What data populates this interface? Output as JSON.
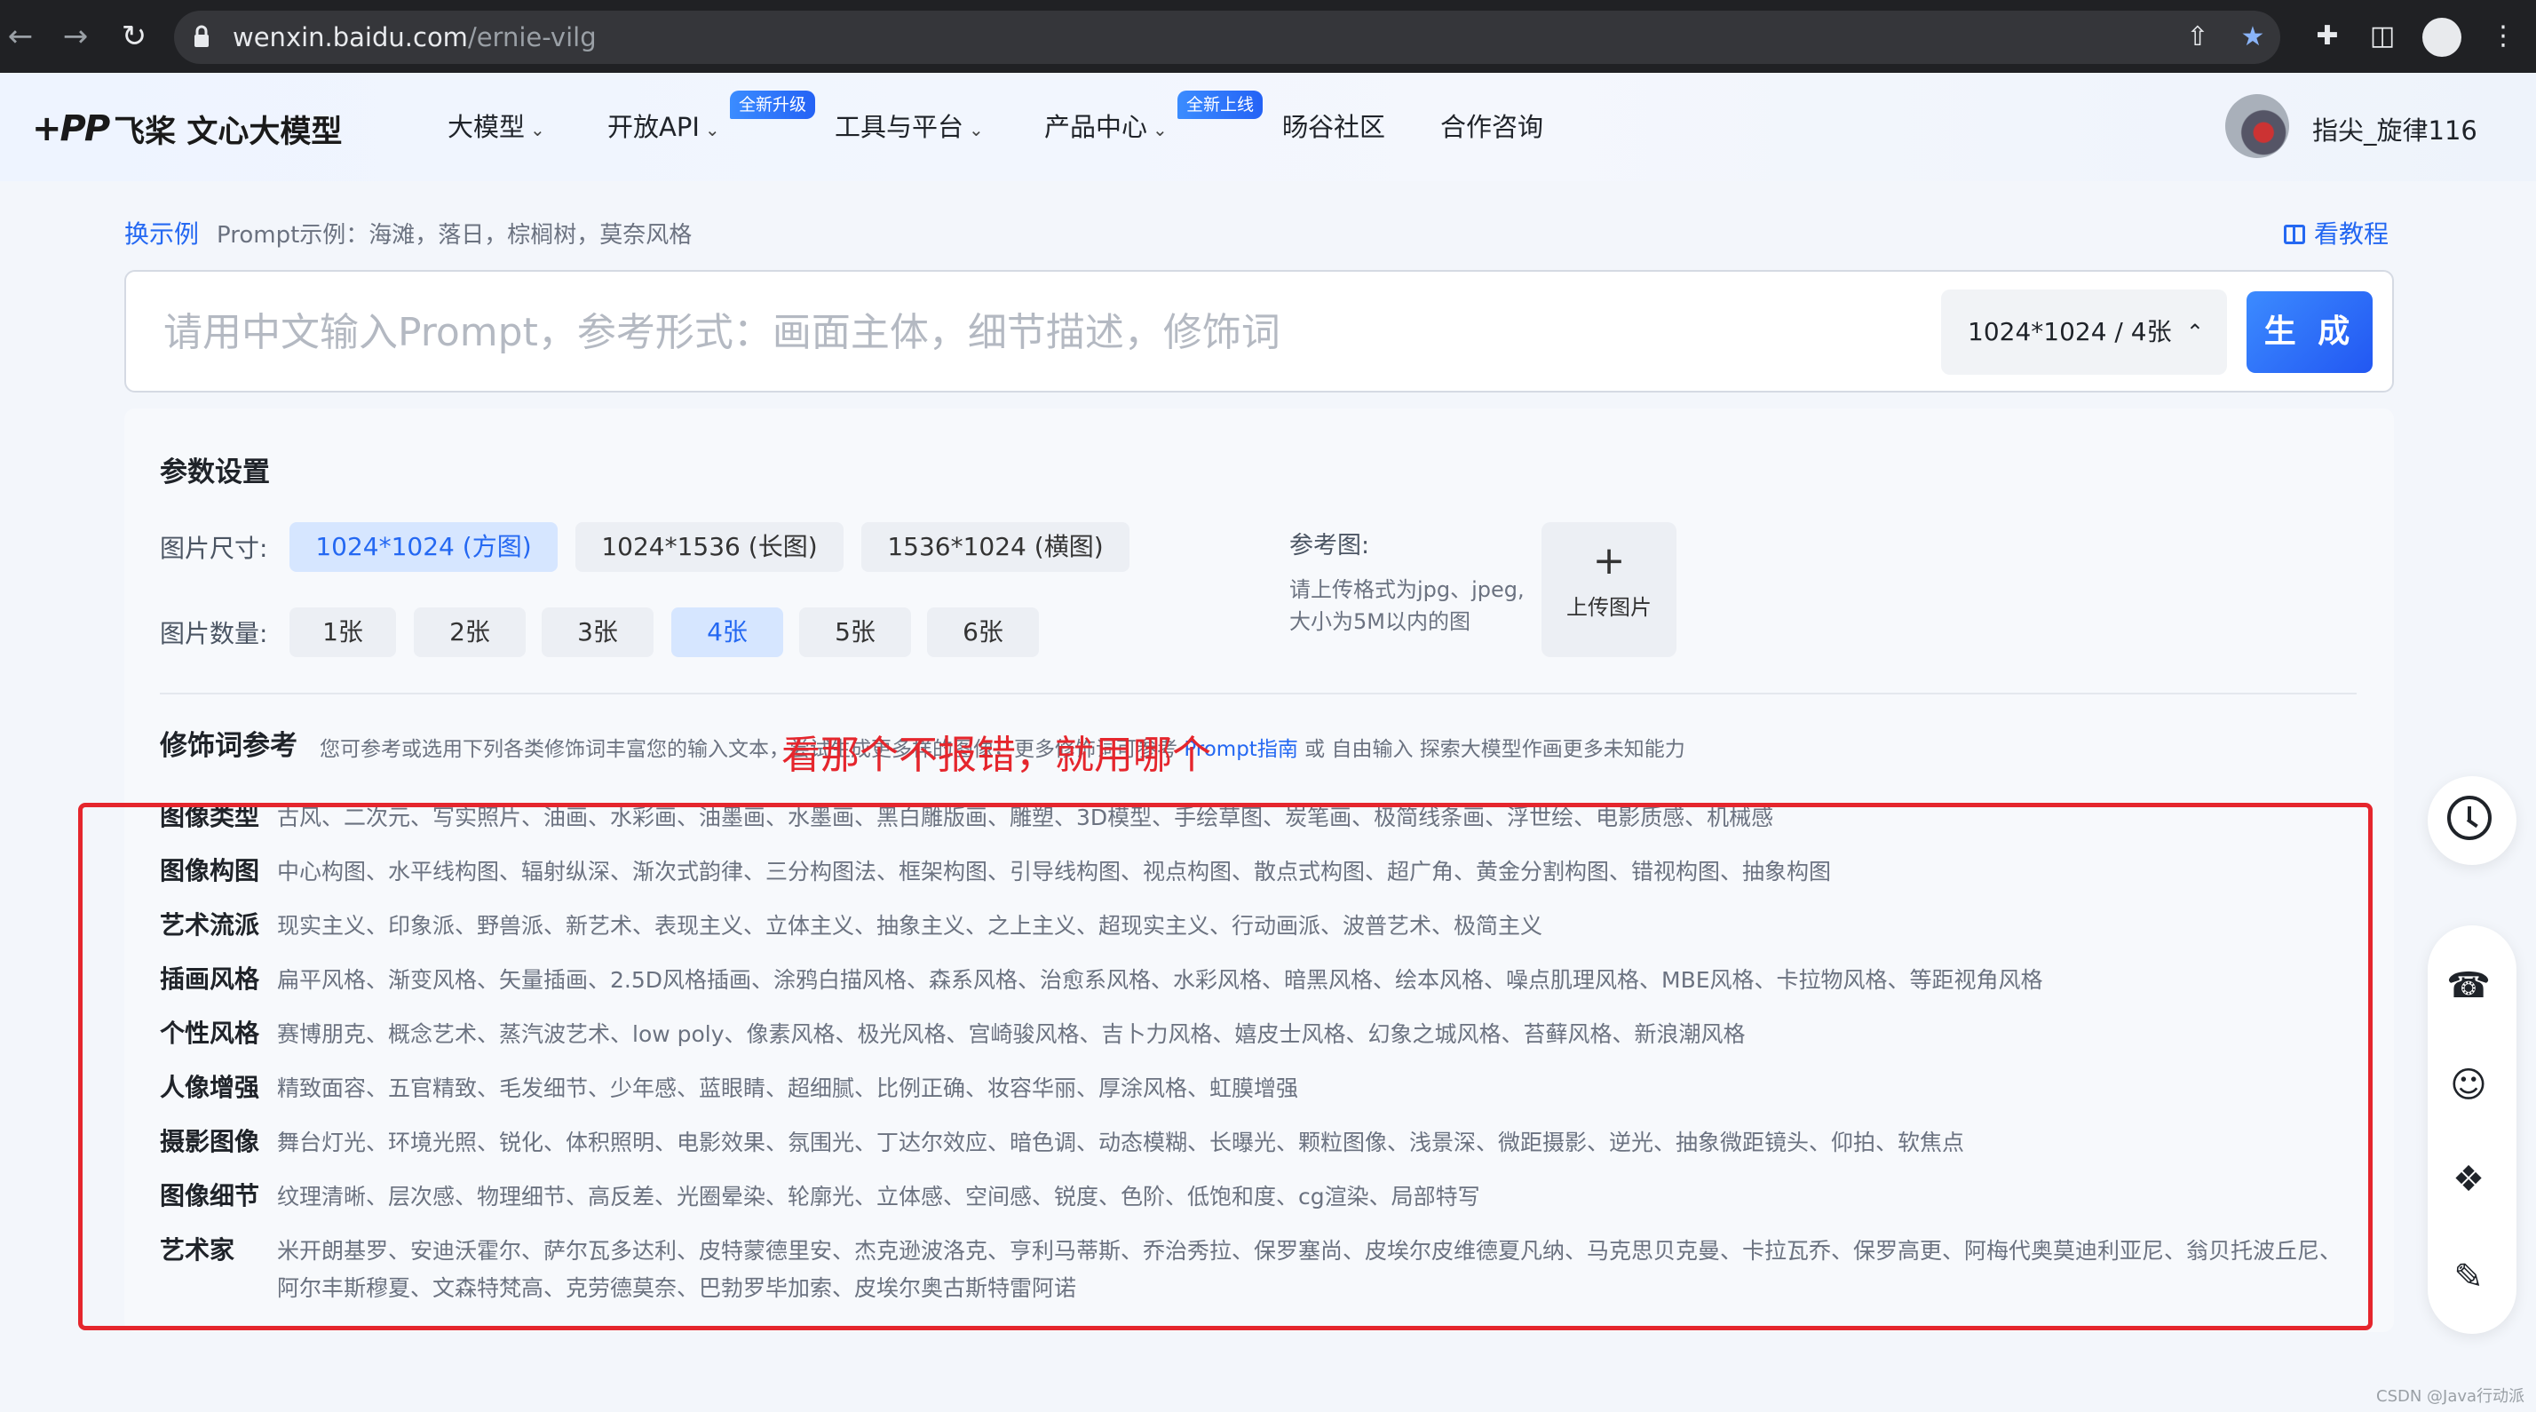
{
  "browser": {
    "url_host": "wenxin.baidu.com",
    "url_path": "/ernie-vilg"
  },
  "header": {
    "logo": "飞桨 文心大模型",
    "nav": [
      {
        "label": "大模型",
        "badge": ""
      },
      {
        "label": "开放API",
        "badge": "全新升级"
      },
      {
        "label": "工具与平台",
        "badge": ""
      },
      {
        "label": "产品中心",
        "badge": "全新上线"
      },
      {
        "label": "旸谷社区",
        "badge": ""
      },
      {
        "label": "合作咨询",
        "badge": ""
      }
    ],
    "username": "指尖_旋律116"
  },
  "examples": {
    "swap_label": "换示例",
    "example_text": "Prompt示例：海滩，落日，棕榈树，莫奈风格",
    "tutorial_label": "看教程"
  },
  "prompt": {
    "placeholder": "请用中文输入Prompt，参考形式：画面主体，细节描述，修饰词",
    "size_select": "1024*1024 / 4张",
    "generate_label": "生 成"
  },
  "params": {
    "title": "参数设置",
    "size_label": "图片尺寸:",
    "sizes": [
      "1024*1024 (方图)",
      "1024*1536 (长图)",
      "1536*1024 (横图)"
    ],
    "selected_size": 0,
    "count_label": "图片数量:",
    "counts": [
      "1张",
      "2张",
      "3张",
      "4张",
      "5张",
      "6张"
    ],
    "selected_count": 3,
    "ref_label": "参考图:",
    "ref_hint": "请上传格式为jpg、jpeg,大小为5M以内的图",
    "upload_label": "上传图片"
  },
  "modifiers": {
    "title": "修饰词参考",
    "desc_prefix": "您可参考或选用下列各类修饰词丰富您的输入文本，尝试生成更多样的图像，更多修饰词可参考",
    "desc_link": "Prompt指南",
    "desc_suffix": "或 自由输入 探索大模型作画更多未知能力",
    "rows": [
      {
        "label": "图像类型",
        "items": "古风、二次元、写实照片、油画、水彩画、油墨画、水墨画、黑白雕版画、雕塑、3D模型、手绘草图、炭笔画、极简线条画、浮世绘、电影质感、机械感"
      },
      {
        "label": "图像构图",
        "items": "中心构图、水平线构图、辐射纵深、渐次式韵律、三分构图法、框架构图、引导线构图、视点构图、散点式构图、超广角、黄金分割构图、错视构图、抽象构图"
      },
      {
        "label": "艺术流派",
        "items": "现实主义、印象派、野兽派、新艺术、表现主义、立体主义、抽象主义、之上主义、超现实主义、行动画派、波普艺术、极简主义"
      },
      {
        "label": "插画风格",
        "items": "扁平风格、渐变风格、矢量插画、2.5D风格插画、涂鸦白描风格、森系风格、治愈系风格、水彩风格、暗黑风格、绘本风格、噪点肌理风格、MBE风格、卡拉物风格、等距视角风格"
      },
      {
        "label": "个性风格",
        "items": "赛博朋克、概念艺术、蒸汽波艺术、low poly、像素风格、极光风格、宫崎骏风格、吉卜力风格、嬉皮士风格、幻象之城风格、苔藓风格、新浪潮风格"
      },
      {
        "label": "人像增强",
        "items": "精致面容、五官精致、毛发细节、少年感、蓝眼睛、超细腻、比例正确、妆容华丽、厚涂风格、虹膜增强"
      },
      {
        "label": "摄影图像",
        "items": "舞台灯光、环境光照、锐化、体积照明、电影效果、氛围光、丁达尔效应、暗色调、动态模糊、长曝光、颗粒图像、浅景深、微距摄影、逆光、抽象微距镜头、仰拍、软焦点"
      },
      {
        "label": "图像细节",
        "items": "纹理清晰、层次感、物理细节、高反差、光圈晕染、轮廓光、立体感、空间感、锐度、色阶、低饱和度、cg渲染、局部特写"
      },
      {
        "label": "艺术家",
        "items": "米开朗基罗、安迪沃霍尔、萨尔瓦多达利、皮特蒙德里安、杰克逊波洛克、亨利马蒂斯、乔治秀拉、保罗塞尚、皮埃尔皮维德夏凡纳、马克思贝克曼、卡拉瓦乔、保罗高更、阿梅代奥莫迪利亚尼、翁贝托波丘尼、阿尔丰斯穆夏、文森特梵高、克劳德莫奈、巴勃罗毕加索、皮埃尔奥古斯特雷阿诺"
      }
    ]
  },
  "annotation": "看那个不报错，就用哪个",
  "watermark": "CSDN @Java行动派",
  "colors": {
    "accent": "#2468f2",
    "annotation": "#e5262d"
  }
}
